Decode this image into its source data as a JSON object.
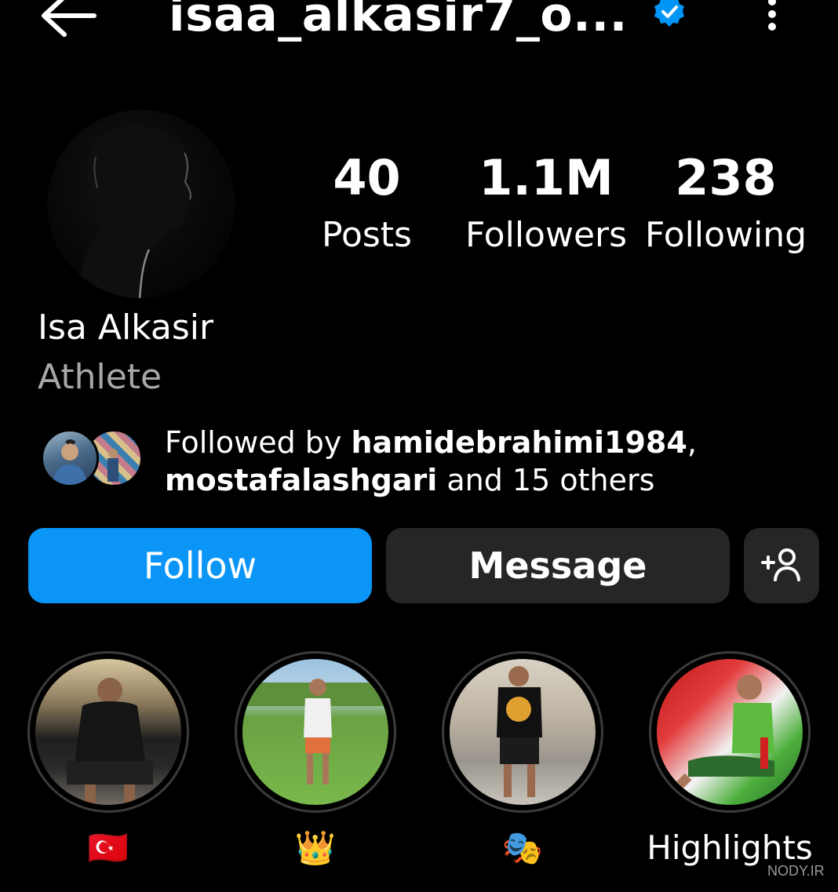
{
  "header": {
    "back_icon": "arrow-left-icon",
    "username": "isaa_alkasir7_o...",
    "verified_icon": "verified-badge-icon",
    "more_icon": "more-vertical-icon"
  },
  "profile": {
    "avatar_alt": "profile-photo",
    "stats": [
      {
        "value": "40",
        "label": "Posts"
      },
      {
        "value": "1.1M",
        "label": "Followers"
      },
      {
        "value": "238",
        "label": "Following"
      }
    ],
    "name": "Isa Alkasir",
    "category": "Athlete"
  },
  "followed_by": {
    "prefix": "Followed by ",
    "user1": "hamidebrahimi1984",
    "separator": ",",
    "user2": "mostafalashgari",
    "suffix": " and 15 others"
  },
  "actions": {
    "follow_label": "Follow",
    "message_label": "Message",
    "add_user_icon": "add-user-icon"
  },
  "highlights": [
    {
      "label": "🇹🇷"
    },
    {
      "label": "👑"
    },
    {
      "label": "🎭"
    },
    {
      "label": "Highlights"
    }
  ],
  "watermark": "NODY.IR",
  "colors": {
    "background": "#000000",
    "follow_button": "#0b95f6",
    "secondary_button": "#262626",
    "verified": "#0095f6",
    "muted_text": "#a8a8a8"
  }
}
